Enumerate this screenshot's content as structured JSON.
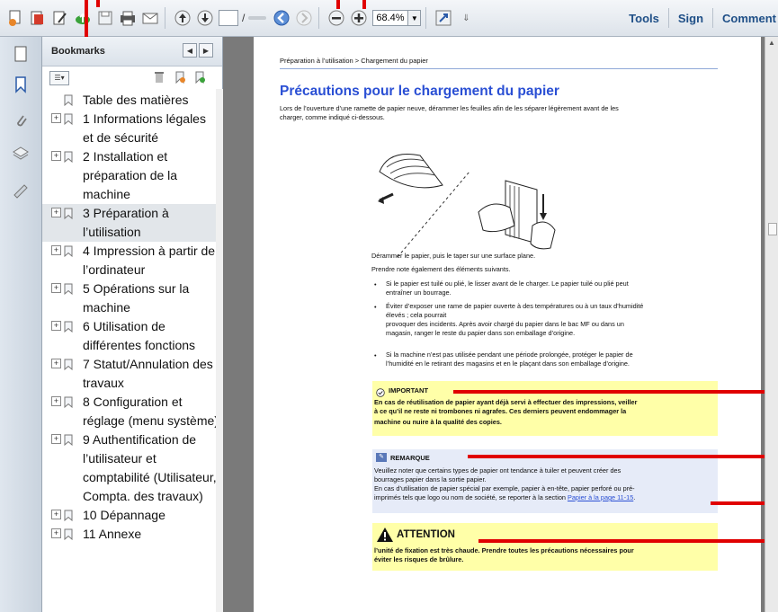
{
  "toolbar": {
    "page_input": "",
    "page_slash": "/",
    "zoom": "68.4%",
    "tools_label": "Tools",
    "sign_label": "Sign",
    "comment_label": "Comment"
  },
  "bookmarks": {
    "title": "Bookmarks",
    "items": [
      {
        "label": "Table des matières",
        "expandable": false
      },
      {
        "label": "1 Informations légales et de sécurité",
        "expandable": true
      },
      {
        "label": "2 Installation et préparation de la machine",
        "expandable": true
      },
      {
        "label": "3 Préparation à l’utilisation",
        "expandable": true,
        "selected": true
      },
      {
        "label": "4 Impression à partir de l’ordinateur",
        "expandable": true
      },
      {
        "label": "5 Opérations sur la machine",
        "expandable": true
      },
      {
        "label": "6 Utilisation de différentes fonctions",
        "expandable": true
      },
      {
        "label": "7 Statut/Annulation des travaux",
        "expandable": true
      },
      {
        "label": "8 Configuration et réglage (menu système)",
        "expandable": true
      },
      {
        "label": "9 Authentification de l’utilisateur et comptabilité (Utilisateur, Compta. des travaux)",
        "expandable": true
      },
      {
        "label": "10 Dépannage",
        "expandable": true
      },
      {
        "label": "11 Annexe",
        "expandable": true
      }
    ]
  },
  "document": {
    "breadcrumb": "Préparation à l’utilisation > Chargement du papier",
    "title": "Précautions pour le chargement du papier",
    "intro_1": "Lors de l’ouverture d’une ramette de papier neuve, dérammer les feuilles afin de les séparer légèrement avant de les",
    "intro_2": "charger, comme indiqué ci-dessous.",
    "para_1": "Dérammer le papier, puis le taper sur une surface plane.",
    "para_2": "Prendre note également des éléments suivants.",
    "bullet_1a": "Si le papier est tuilé ou plié, le lisser avant de le charger. Le papier tuilé ou plié peut",
    "bullet_1b": "entraîner un bourrage.",
    "bullet_2a": "Éviter d’exposer une rame de papier ouverte à des températures ou à un taux d’humidité",
    "bullet_2b": "élevés ; cela pourrait",
    "bullet_2c": "provoquer des incidents. Après avoir chargé du papier dans le bac MF ou dans un",
    "bullet_2d": "magasin, ranger le reste du papier dans son emballage d’origine.",
    "bullet_3a": "Si la machine n’est pas utilisée pendant une période prolongée, protéger le papier de",
    "bullet_3b": "l’humidité en le retirant des magasins et en le plaçant dans son emballage d’origine.",
    "important_head": "IMPORTANT",
    "important_1": "En cas de réutilisation de papier ayant déjà servi à effectuer des impressions, veiller",
    "important_2": "à ce qu’il ne reste ni trombones ni agrafes. Ces derniers peuvent endommager la",
    "important_3": "machine ou nuire à la qualité des copies.",
    "remarque_head": "REMARQUE",
    "remarque_1": "Veuillez noter que certains types de papier ont tendance à tuiler et peuvent créer des",
    "remarque_2": "bourrages papier dans la sortie papier.",
    "remarque_3": "En cas d’utilisation de papier spécial par exemple, papier à en-tête, papier perforé ou pré-",
    "remarque_4": "imprimés tels que logo ou nom de société, se reporter à la section",
    "remarque_link": "Papier à la page 11-15",
    "remarque_5": ".",
    "attention_head": "ATTENTION",
    "attention_1": "l’unité de fixation est très chaude. Prendre toutes les précautions nécessaires pour",
    "attention_2": "éviter les risques de brûlure."
  },
  "colors": {
    "accent_title": "#2a4fd4",
    "callout_red": "#e00000",
    "important_bg": "#ffffa8",
    "remarque_bg": "#e6ebf8"
  }
}
